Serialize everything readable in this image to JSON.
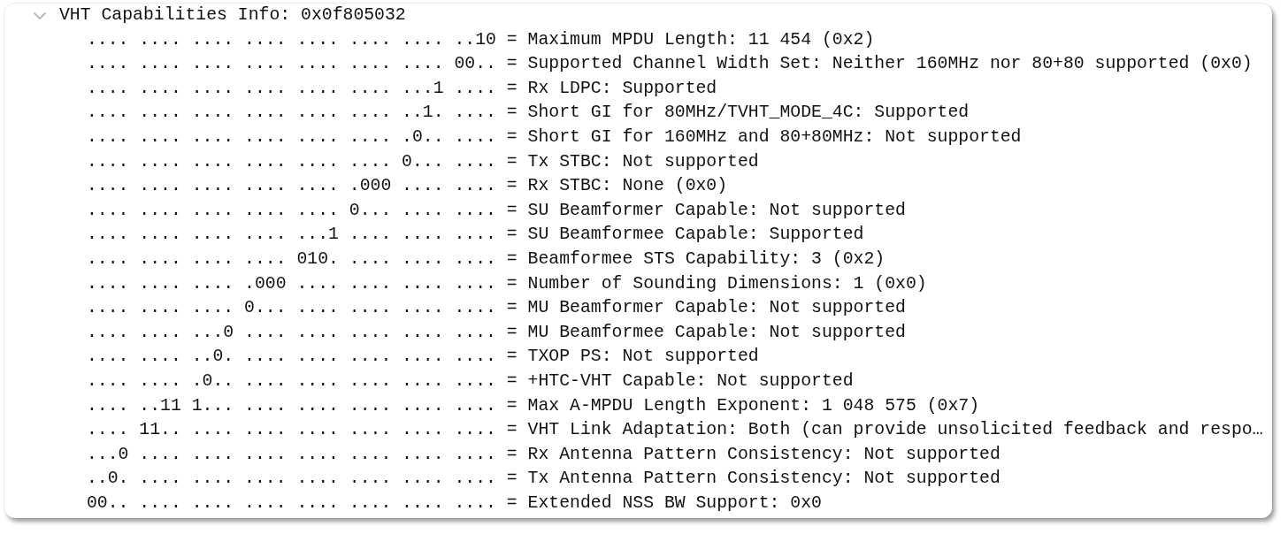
{
  "tree": {
    "label": "VHT Capabilities Info: 0x0f805032",
    "expanded": true,
    "children": [
      {
        "label": ".... .... .... .... .... .... .... ..10 = Maximum MPDU Length: 11 454 (0x2)"
      },
      {
        "label": ".... .... .... .... .... .... .... 00.. = Supported Channel Width Set: Neither 160MHz nor 80+80 supported (0x0)"
      },
      {
        "label": ".... .... .... .... .... .... ...1 .... = Rx LDPC: Supported"
      },
      {
        "label": ".... .... .... .... .... .... ..1. .... = Short GI for 80MHz/TVHT_MODE_4C: Supported"
      },
      {
        "label": ".... .... .... .... .... .... .0.. .... = Short GI for 160MHz and 80+80MHz: Not supported"
      },
      {
        "label": ".... .... .... .... .... .... 0... .... = Tx STBC: Not supported"
      },
      {
        "label": ".... .... .... .... .... .000 .... .... = Rx STBC: None (0x0)"
      },
      {
        "label": ".... .... .... .... .... 0... .... .... = SU Beamformer Capable: Not supported"
      },
      {
        "label": ".... .... .... .... ...1 .... .... .... = SU Beamformee Capable: Supported"
      },
      {
        "label": ".... .... .... .... 010. .... .... .... = Beamformee STS Capability: 3 (0x2)"
      },
      {
        "label": ".... .... .... .000 .... .... .... .... = Number of Sounding Dimensions: 1 (0x0)"
      },
      {
        "label": ".... .... .... 0... .... .... .... .... = MU Beamformer Capable: Not supported"
      },
      {
        "label": ".... .... ...0 .... .... .... .... .... = MU Beamformee Capable: Not supported"
      },
      {
        "label": ".... .... ..0. .... .... .... .... .... = TXOP PS: Not supported"
      },
      {
        "label": ".... .... .0.. .... .... .... .... .... = +HTC-VHT Capable: Not supported"
      },
      {
        "label": ".... ..11 1... .... .... .... .... .... = Max A-MPDU Length Exponent: 1 048 575 (0x7)"
      },
      {
        "label": ".... 11.. .... .... .... .... .... .... = VHT Link Adaptation: Both (can provide unsolicited feedback and respo…"
      },
      {
        "label": "...0 .... .... .... .... .... .... .... = Rx Antenna Pattern Consistency: Not supported"
      },
      {
        "label": "..0. .... .... .... .... .... .... .... = Tx Antenna Pattern Consistency: Not supported"
      },
      {
        "label": "00.. .... .... .... .... .... .... .... = Extended NSS BW Support: 0x0"
      }
    ]
  }
}
